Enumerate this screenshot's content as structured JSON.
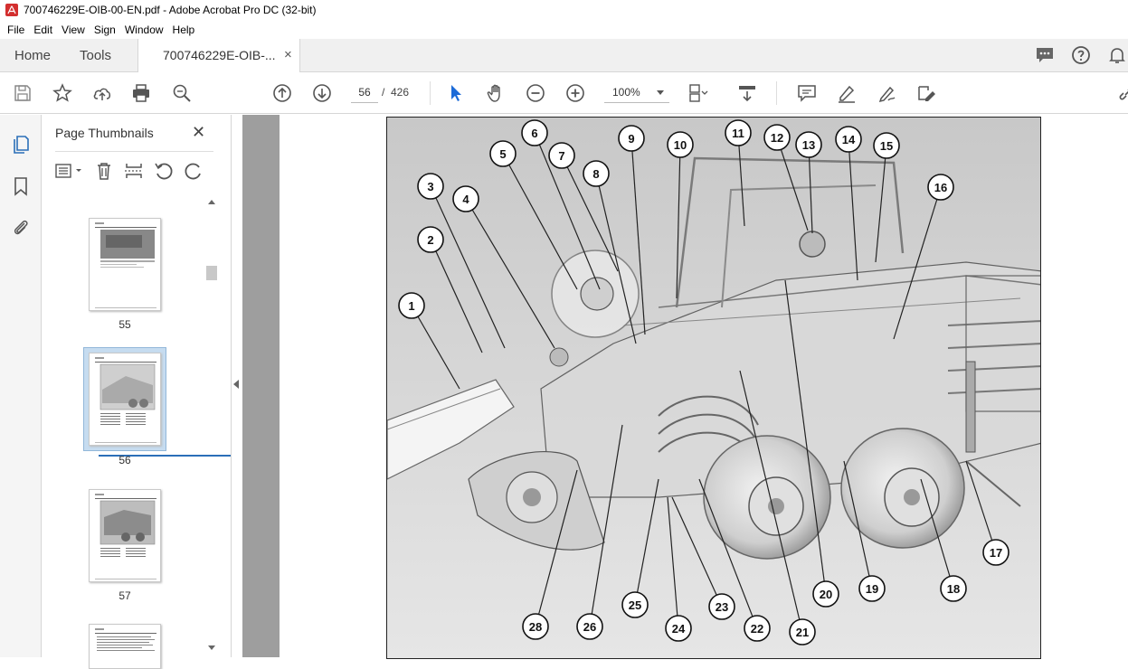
{
  "window": {
    "title": "700746229E-OIB-00-EN.pdf - Adobe Acrobat Pro DC (32-bit)"
  },
  "menu": [
    "File",
    "Edit",
    "View",
    "Sign",
    "Window",
    "Help"
  ],
  "tabs": {
    "home": "Home",
    "tools": "Tools",
    "document": "700746229E-OIB-...",
    "document_close": "×"
  },
  "toolbar": {
    "page_current": "56",
    "page_separator": "/",
    "page_total": "426",
    "zoom": "100%"
  },
  "panel": {
    "title": "Page Thumbnails",
    "close": "✕",
    "thumbnails": [
      {
        "label": "55",
        "selected": false
      },
      {
        "label": "56",
        "selected": true
      },
      {
        "label": "57",
        "selected": false
      }
    ]
  },
  "figure": {
    "callouts": [
      "1",
      "2",
      "3",
      "4",
      "5",
      "6",
      "7",
      "8",
      "9",
      "10",
      "11",
      "12",
      "13",
      "14",
      "15",
      "16",
      "17",
      "18",
      "19",
      "20",
      "21",
      "22",
      "23",
      "24",
      "25",
      "26",
      "28"
    ]
  },
  "colors": {
    "accent": "#2b6fb8",
    "pointer_blue": "#1c6bd8",
    "acrobat_red": "#d32f2f"
  }
}
